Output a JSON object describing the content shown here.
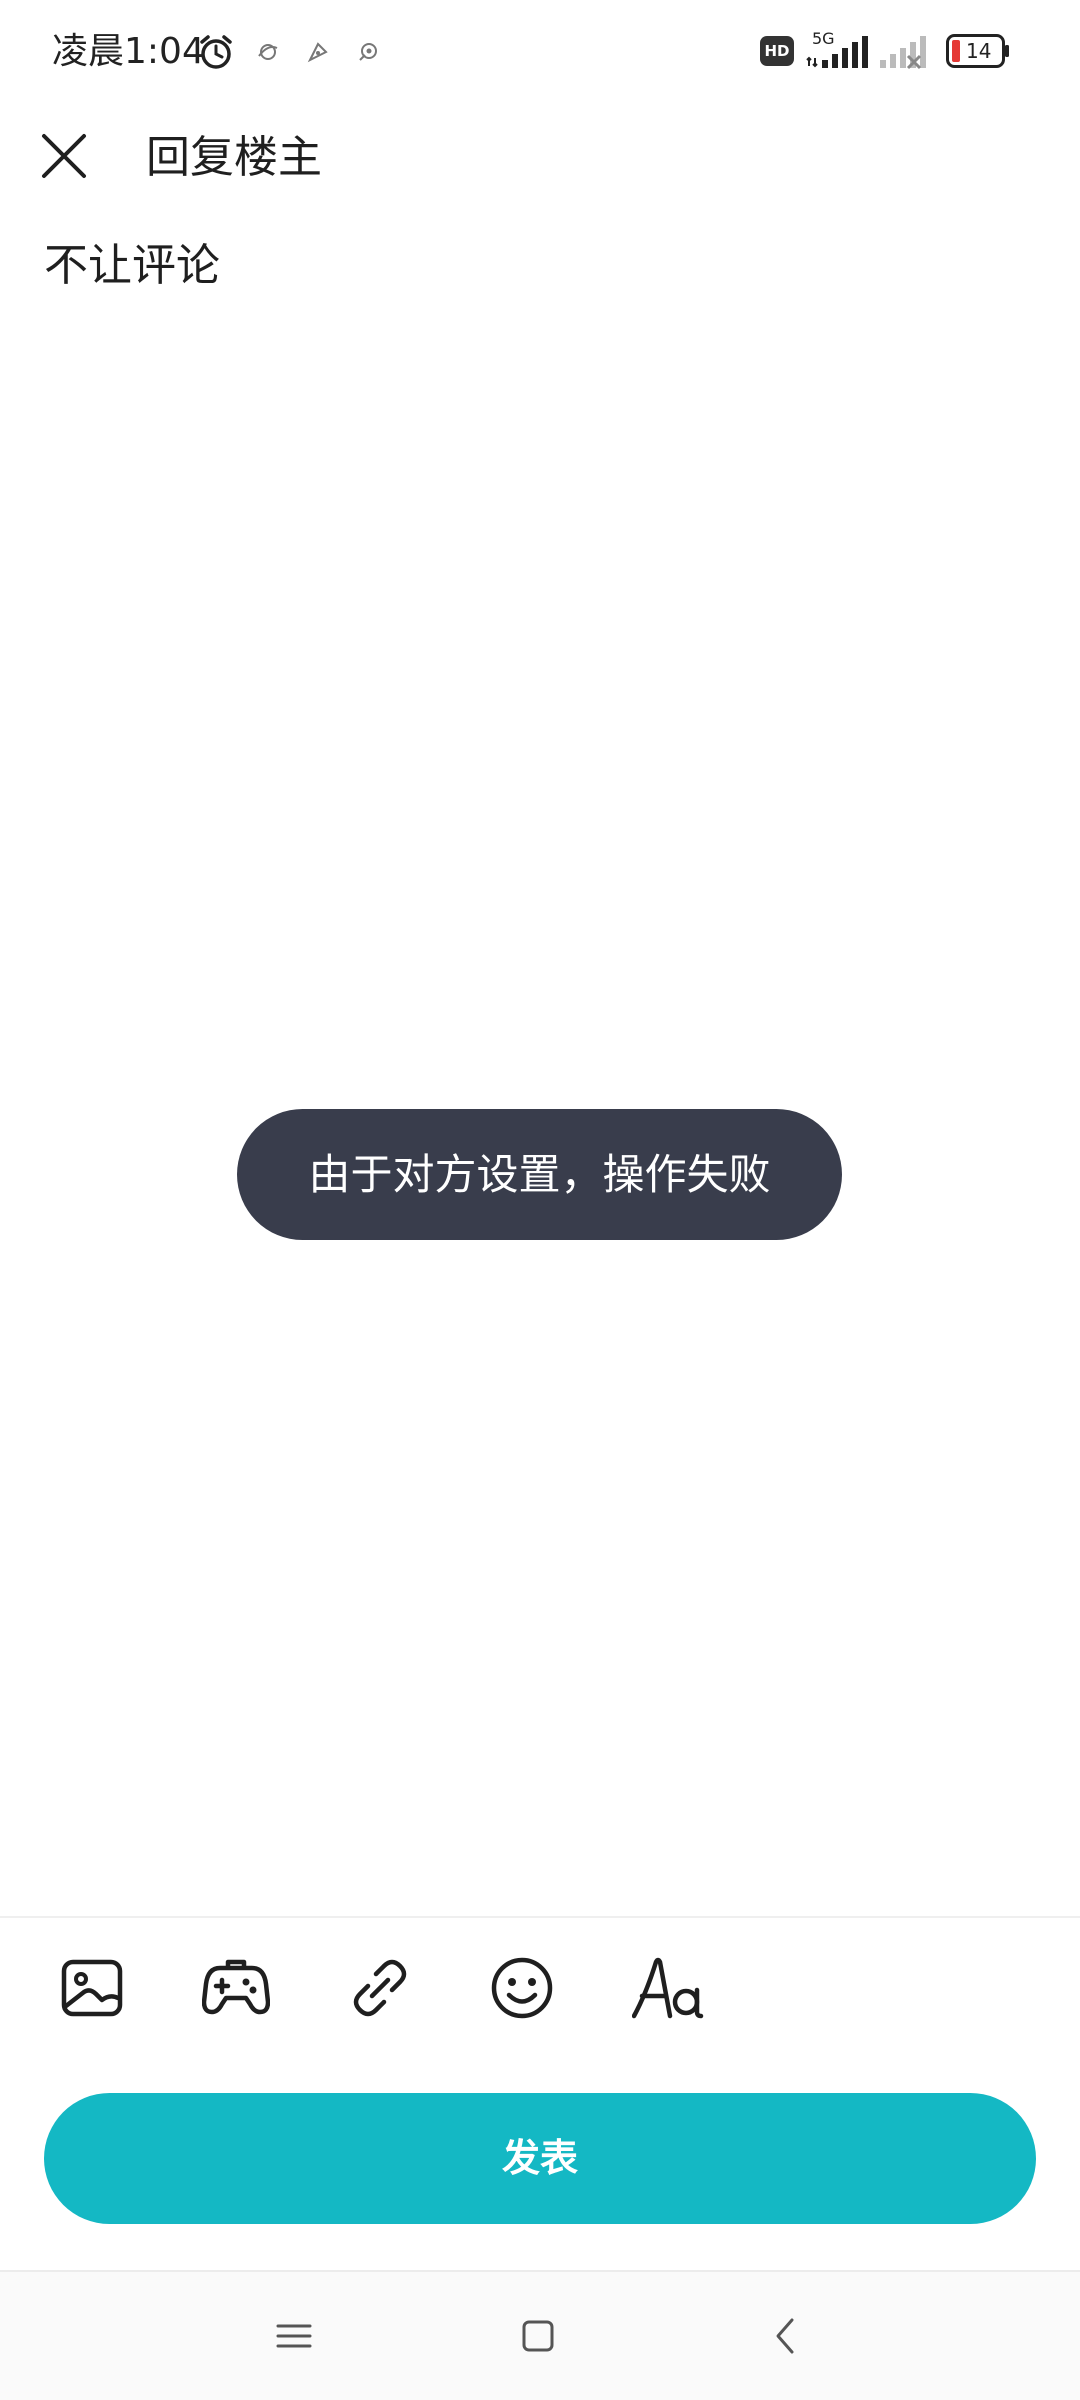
{
  "status_bar": {
    "time": "凌晨1:04",
    "network": "5G",
    "hd": "HD",
    "battery": "14"
  },
  "header": {
    "title": "回复楼主"
  },
  "reply": {
    "text": "不让评论"
  },
  "toast": {
    "message": "由于对方设置，操作失败"
  },
  "toolbar": {
    "tools": [
      "image-icon",
      "gamepad-icon",
      "link-icon",
      "emoji-icon",
      "font-icon"
    ]
  },
  "publish": {
    "label": "发表"
  },
  "colors": {
    "accent": "#14b8c4",
    "toast_bg": "#393d4c",
    "battery_low": "#e53935"
  }
}
